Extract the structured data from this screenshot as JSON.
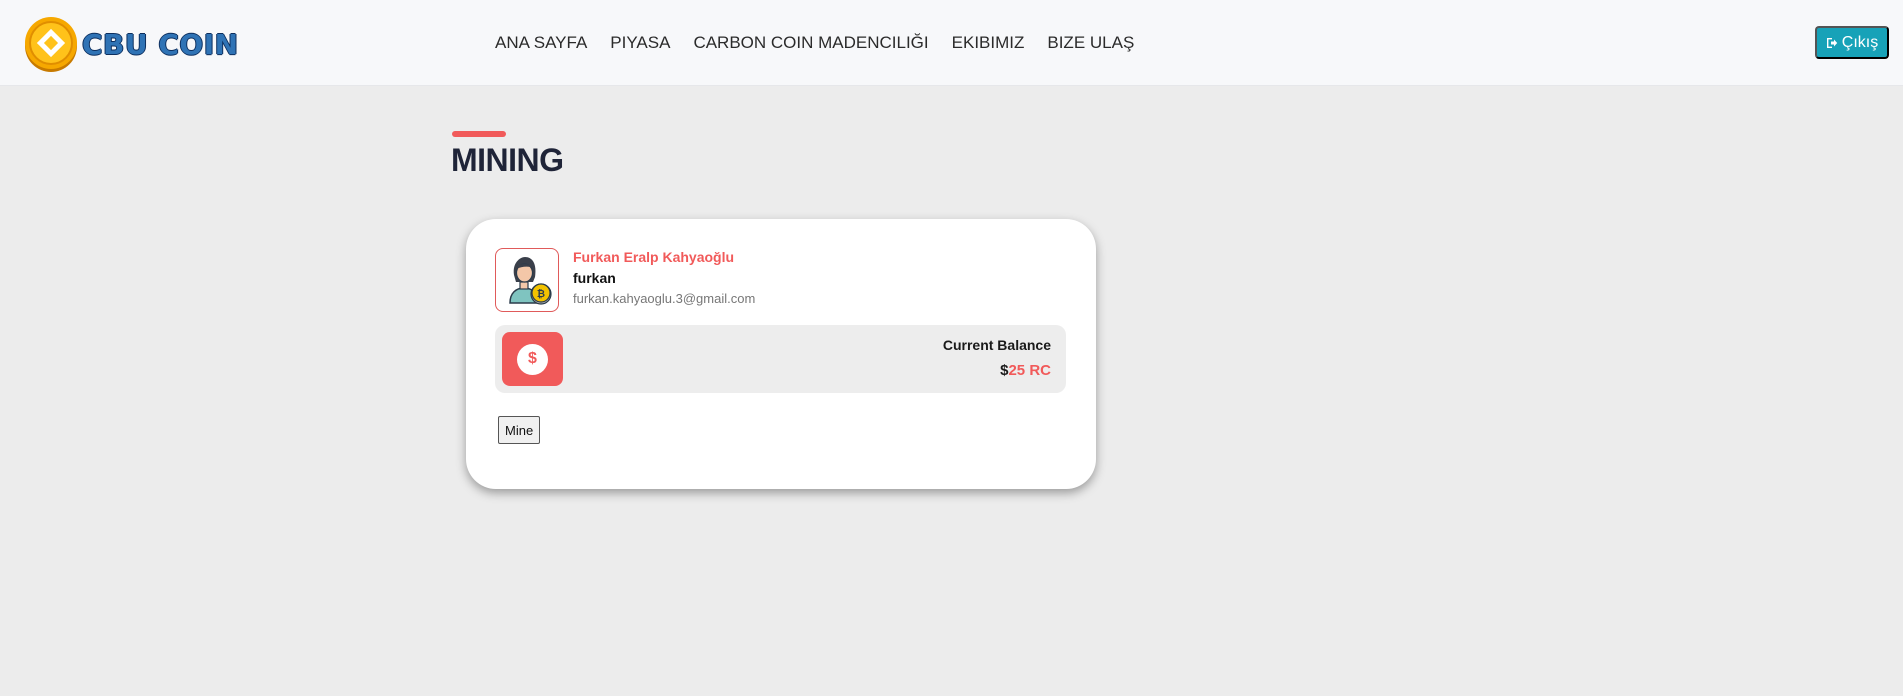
{
  "brand": {
    "name": "CBU COIN"
  },
  "nav": {
    "items": [
      {
        "label": "ANA SAYFA"
      },
      {
        "label": "PIYASA"
      },
      {
        "label": "CARBON COIN MADENCILIĞI"
      },
      {
        "label": "EKIBIMIZ"
      },
      {
        "label": "BIZE ULAŞ"
      }
    ],
    "logout_label": "Çıkış",
    "logout_icon": "sign-out-icon"
  },
  "page": {
    "title": "MINING"
  },
  "user": {
    "full_name": "Furkan Eralp Kahyaoğlu",
    "username": "furkan",
    "email": "furkan.kahyaoglu.3@gmail.com",
    "avatar_icon": "user-bitcoin-avatar-icon"
  },
  "balance": {
    "label": "Current Balance",
    "currency_symbol": "$",
    "amount": "25 RC",
    "icon": "dollar-icon"
  },
  "actions": {
    "mine_label": "Mine"
  },
  "colors": {
    "accent": "#f15a5a",
    "logout_button": "#17a2b8",
    "title_text": "#1f2438",
    "brand_blue": "#2f73b5",
    "coin_gold": "#f6a800"
  }
}
